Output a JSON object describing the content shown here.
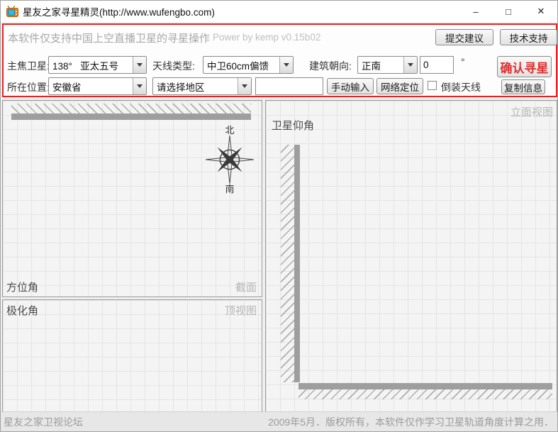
{
  "window": {
    "title": "星友之家寻星精灵(http://www.wufengbo.com)",
    "minimize": "–",
    "maximize": "□",
    "close": "✕"
  },
  "header": {
    "notice": "本软件仅支持中国上空直播卫星的寻星操作",
    "power": "Power by kemp  v0.15b02",
    "suggest_button": "提交建议",
    "support_button": "技术支持"
  },
  "form": {
    "satellite_label": "主焦卫星:",
    "satellite_value": "138°   亚太五号",
    "antenna_label": "天线类型:",
    "antenna_value": "中卫60cm偏馈",
    "orientation_label": "建筑朝向:",
    "orientation_value": "正南",
    "orientation_offset": "0",
    "degree_symbol": "°",
    "confirm_button": "确认寻星",
    "location_label": "所在位置:",
    "province_value": "安徽省",
    "district_value": "请选择地区",
    "city_input_value": "",
    "manual_button": "手动输入",
    "locate_button": "网络定位",
    "invert_label": "倒装天线",
    "copy_button": "复制信息"
  },
  "views": {
    "elevation_title": "卫星仰角",
    "elevation_view_tag": "立面视图",
    "azimuth_title": "方位角",
    "azimuth_view_tag": "截面",
    "polarization_title": "极化角",
    "polarization_view_tag": "顶视图",
    "compass_north": "北",
    "compass_south": "南"
  },
  "statusbar": {
    "left": "星友之家卫视论坛",
    "right": "2009年5月．版权所有，本软件仅作学习卫星轨道角度计算之用．"
  },
  "colors": {
    "accent_red": "#e32424",
    "confirm_text_red": "#e02f2f",
    "wall_gray": "#9e9e9e"
  }
}
